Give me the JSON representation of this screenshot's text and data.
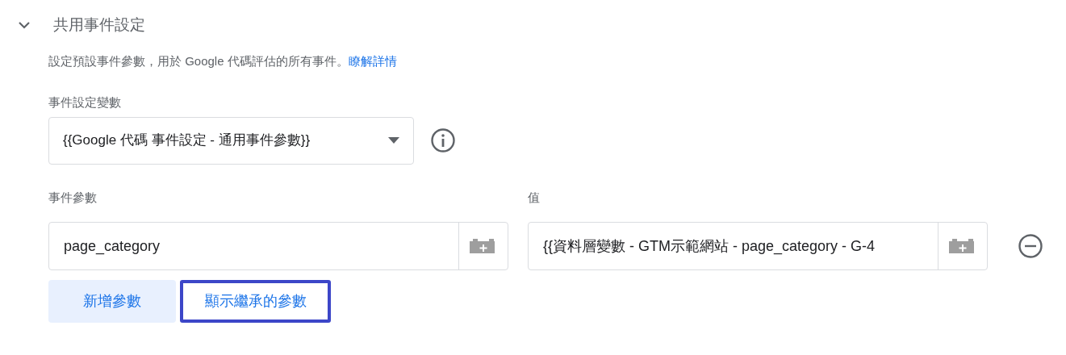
{
  "section": {
    "title": "共用事件設定",
    "expanded": true,
    "description": "設定預設事件參數，用於 Google 代碼評估的所有事件。",
    "link": "瞭解詳情"
  },
  "settings_variable": {
    "label": "事件設定變數",
    "value": "{{Google 代碼 事件設定 - 通用事件參數}}"
  },
  "parameters": {
    "columns": [
      "事件參數",
      "值"
    ],
    "rows": [
      {
        "name": "page_category",
        "value": "{{資料層變數 - GTM示範網站 - page_category - G-4"
      }
    ]
  },
  "buttons": [
    {
      "label": "新增參數",
      "kind": "filled",
      "highlighted": false
    },
    {
      "label": "顯示繼承的參數",
      "kind": "text",
      "highlighted": true
    }
  ]
}
